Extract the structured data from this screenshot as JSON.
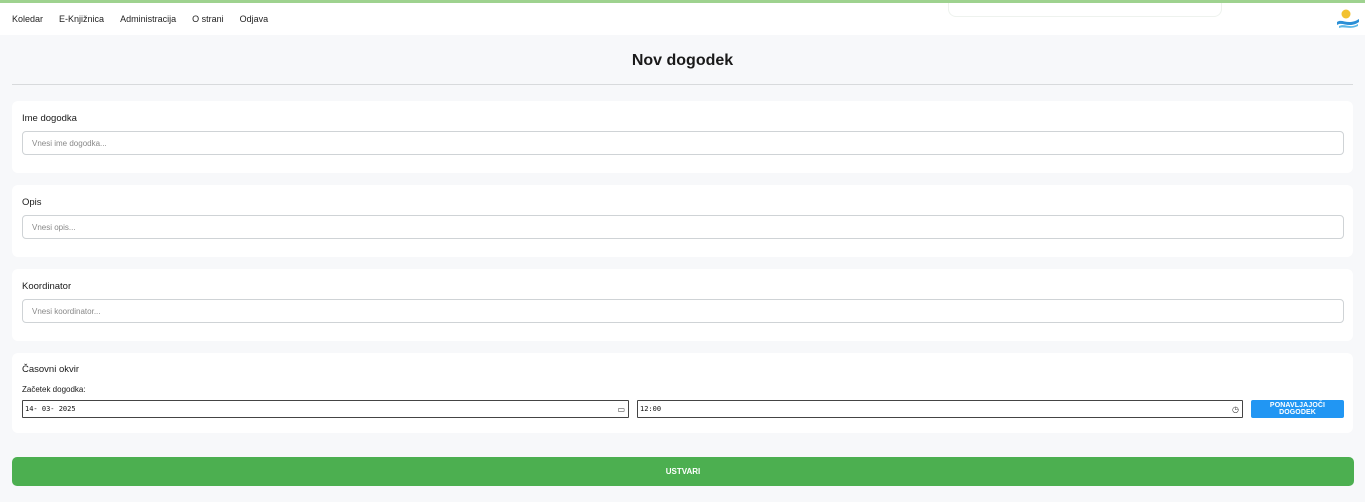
{
  "nav": {
    "items": [
      "Koledar",
      "E-Knjižnica",
      "Administracija",
      "O strani",
      "Odjava"
    ],
    "logo_icon": "logo-icon"
  },
  "page": {
    "title": "Nov dogodek"
  },
  "form": {
    "name": {
      "label": "Ime dogodka",
      "placeholder": "Vnesi ime dogodka..."
    },
    "description": {
      "label": "Opis",
      "placeholder": "Vnesi opis..."
    },
    "coordinator": {
      "label": "Koordinator",
      "placeholder": "Vnesi koordinator..."
    },
    "timeframe": {
      "label": "Časovni okvir",
      "start_label": "Začetek dogodka:",
      "date_value": "14- 03- 2025",
      "time_value": "12:00",
      "repeat_button": "PONAVLJAJOČI DOGODEK"
    },
    "submit_label": "USTVARI"
  },
  "colors": {
    "primary_green": "#4caf50",
    "accent_blue": "#2196f3",
    "topline": "#9ed28f"
  }
}
